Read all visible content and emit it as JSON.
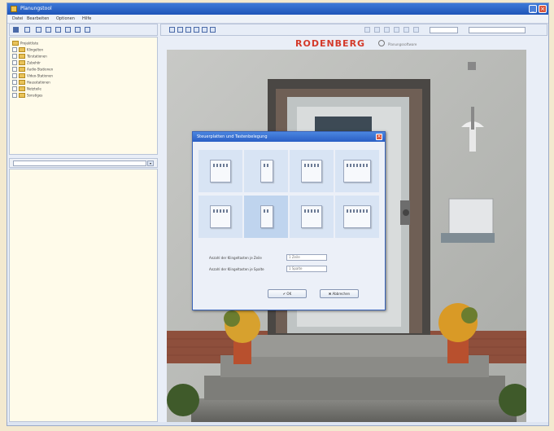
{
  "window": {
    "title": "Planungstool"
  },
  "menu": [
    "Datei",
    "Bearbeiten",
    "Optionen",
    "Hilfe"
  ],
  "tree": {
    "items": [
      {
        "label": "Projektliste",
        "level": 0
      },
      {
        "label": "Klingelton",
        "level": 1
      },
      {
        "label": "Türstationen",
        "level": 1
      },
      {
        "label": "Zubehör",
        "level": 1
      },
      {
        "label": "Audio-Stationen",
        "level": 1
      },
      {
        "label": "Video-Stationen",
        "level": 1
      },
      {
        "label": "Hausstationen",
        "level": 1
      },
      {
        "label": "Netzteile",
        "level": 1
      },
      {
        "label": "Sonstiges",
        "level": 1
      }
    ]
  },
  "brand": {
    "name": "RODENBERG",
    "sub": "Planungssoftware"
  },
  "dialog": {
    "title": "Steuerplatten und Tastenbelegung",
    "field1_label": "Anzahl der Klingeltasten je Zeile",
    "field1_value": "1 Zeile",
    "field2_label": "Anzahl der Klingeltasten je Spalte",
    "field2_value": "1 Spalte",
    "ok_label": "✔ OK",
    "cancel_label": "✖ Abbrechen"
  },
  "colors": {
    "accent": "#2a5ec4",
    "brand": "#d43a2a",
    "pane": "#fffbea"
  }
}
